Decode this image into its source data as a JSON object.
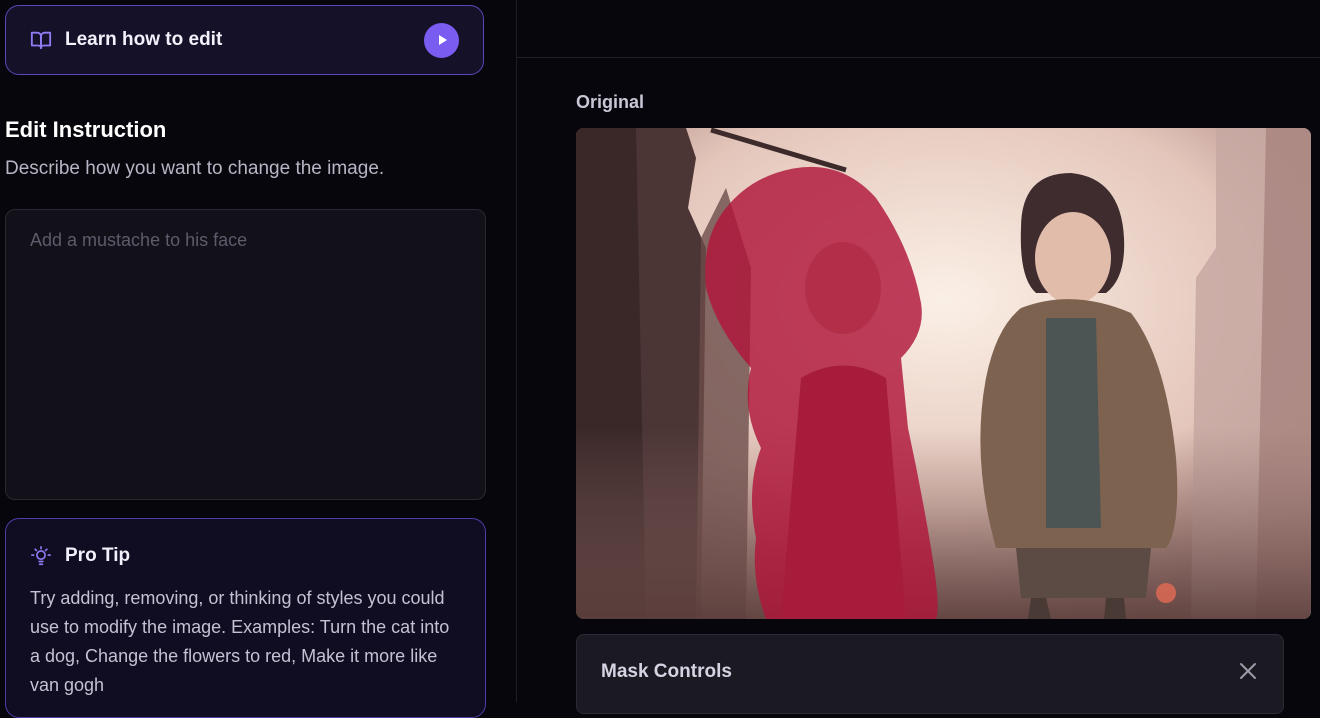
{
  "learn": {
    "label": "Learn how to edit",
    "icon": "book-open-icon",
    "play_icon": "play-icon"
  },
  "instruction": {
    "title": "Edit Instruction",
    "description": "Describe how you want to change the image.",
    "placeholder": "Add a mustache to his face",
    "value": ""
  },
  "tip": {
    "icon": "lightbulb-icon",
    "title": "Pro Tip",
    "text": "Try adding, removing, or thinking of styles you could use to modify the image. Examples: Turn the cat into a dog, Change the flowers to red, Make it more like van gogh"
  },
  "preview": {
    "label": "Original"
  },
  "mask_controls": {
    "title": "Mask Controls",
    "close_icon": "close-icon"
  },
  "colors": {
    "accent": "#7a5cf0",
    "mask": "#b0163a",
    "background": "#07060c"
  }
}
